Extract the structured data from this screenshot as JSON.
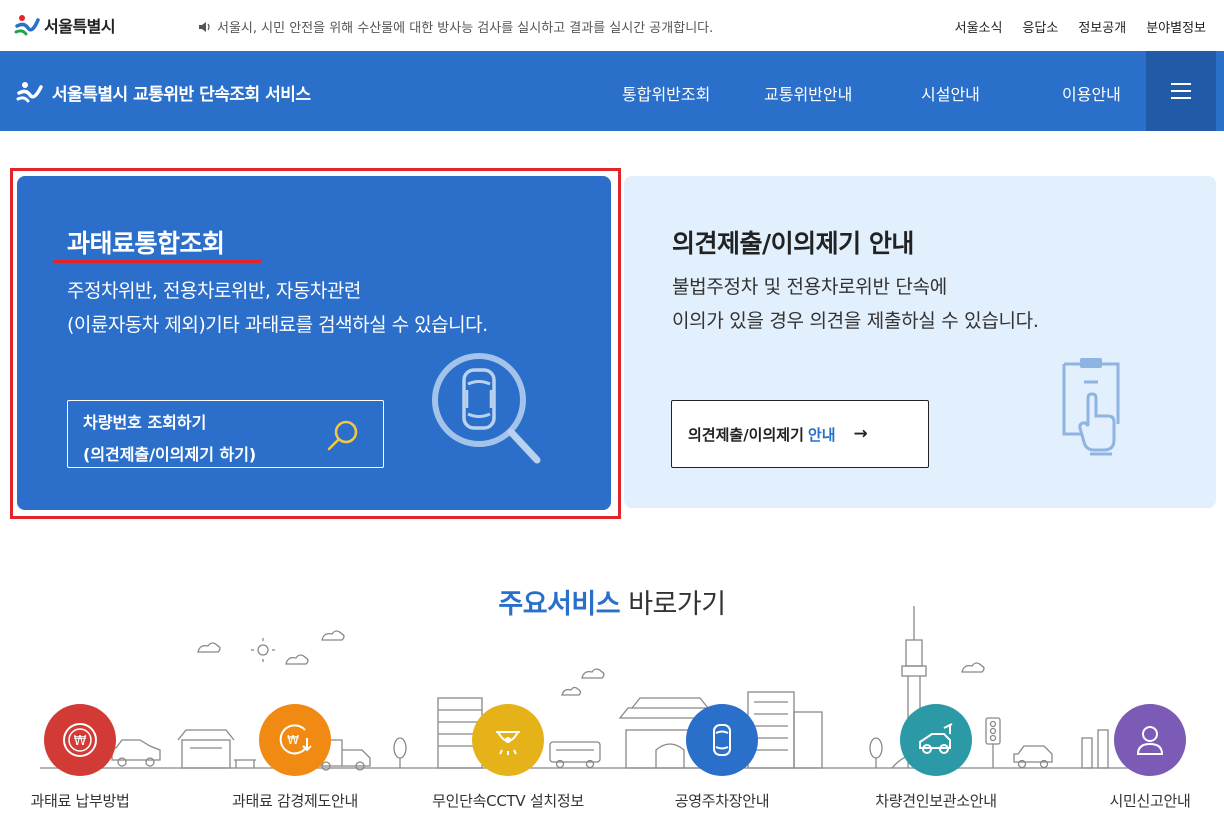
{
  "topbar": {
    "logo_text": "서울특별시",
    "notice": "서울시, 시민 안전을 위해 수산물에 대한 방사능 검사를 실시하고 결과를 실시간 공개합니다.",
    "links": [
      "서울소식",
      "응답소",
      "정보공개",
      "분야별정보"
    ]
  },
  "navbar": {
    "brand": "서울특별시 교통위반 단속조회 서비스",
    "menu": [
      "통합위반조회",
      "교통위반안내",
      "시설안내",
      "이용안내"
    ]
  },
  "card_left": {
    "title": "과태료통합조회",
    "desc_line1": "주정차위반, 전용차로위반, 자동차관련",
    "desc_line2": "(이륜자동차 제외)기타 과태료를 검색하실 수 있습니다.",
    "button_line1": "차량번호 조회하기",
    "button_line2": "(의견제출/이의제기 하기)"
  },
  "card_right": {
    "title": "의견제출/이의제기 안내",
    "desc_line1": "불법주정차 및 전용차로위반 단속에",
    "desc_line2": "이의가 있을 경우 의견을 제출하실 수 있습니다.",
    "button_main": "의견제출/이의제기",
    "button_accent": "안내",
    "button_arrow": "→"
  },
  "services": {
    "heading_strong": "주요서비스",
    "heading_normal": "바로가기",
    "items": [
      {
        "label": "과태료 납부방법",
        "icon": "won-coin-icon",
        "color": "#d23a36"
      },
      {
        "label": "과태료 감경제도안내",
        "icon": "won-discount-icon",
        "color": "#f08a12"
      },
      {
        "label": "무인단속CCTV 설치정보",
        "icon": "cctv-icon",
        "color": "#e6b21a"
      },
      {
        "label": "공영주차장안내",
        "icon": "car-top-icon",
        "color": "#2a6fca"
      },
      {
        "label": "차량견인보관소안내",
        "icon": "tow-truck-icon",
        "color": "#2b9aa6"
      },
      {
        "label": "시민신고안내",
        "icon": "person-icon",
        "color": "#7c5bb6"
      }
    ]
  },
  "colors": {
    "primary": "#2a6fca",
    "highlight_border": "#e3242b",
    "card_right_bg": "#e2effc"
  }
}
